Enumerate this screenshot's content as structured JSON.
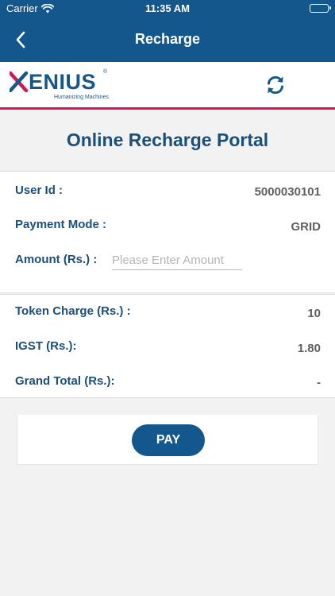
{
  "status_bar": {
    "carrier": "Carrier",
    "time": "11:35 AM",
    "battery_level": 1.0
  },
  "nav": {
    "title": "Recharge",
    "back_icon": "chevron-left-icon"
  },
  "brand": {
    "logo_letters": "ENIUS",
    "logo_registered": "®",
    "tagline": "Humanizing Machines",
    "refresh_icon": "refresh-icon"
  },
  "portal": {
    "title": "Online Recharge Portal"
  },
  "user_details": {
    "user_id_label": "User Id :",
    "user_id_value": "5000030101",
    "payment_mode_label": "Payment Mode :",
    "payment_mode_value": "GRID",
    "amount_label": "Amount (Rs.) :",
    "amount_value": "",
    "amount_placeholder": "Please Enter Amount"
  },
  "charges": {
    "token_charge_label": "Token Charge (Rs.) :",
    "token_charge_value": "10",
    "igst_label": "IGST (Rs.):",
    "igst_value": "1.80",
    "grand_total_label": "Grand Total (Rs.):",
    "grand_total_value": "-"
  },
  "actions": {
    "pay_label": "PAY"
  },
  "colors": {
    "primary": "#14578c",
    "heading": "#1b4e79",
    "accent": "#d2194f",
    "background": "#f2f2f2"
  }
}
